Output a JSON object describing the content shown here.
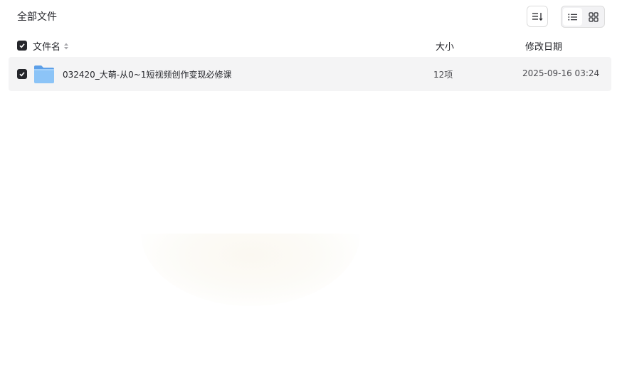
{
  "breadcrumb": {
    "title": "全部文件"
  },
  "toolbar": {
    "sort_icon": "sort-icon",
    "view_modes": [
      {
        "icon": "list-view-icon",
        "active": true
      },
      {
        "icon": "grid-view-icon",
        "active": false
      }
    ]
  },
  "table": {
    "columns": {
      "name": "文件名",
      "size": "大小",
      "date": "修改日期"
    },
    "select_all_checked": true,
    "rows": [
      {
        "icon": "folder-icon",
        "checked": true,
        "name": "032420_大萌-从0~1短视频创作变现必修课",
        "size": "12项",
        "date": "2025-09-16 03:24"
      }
    ]
  },
  "colors": {
    "accent": "#25262b",
    "row_selected_bg": "#f4f4f5",
    "folder": "#6aaef0"
  }
}
